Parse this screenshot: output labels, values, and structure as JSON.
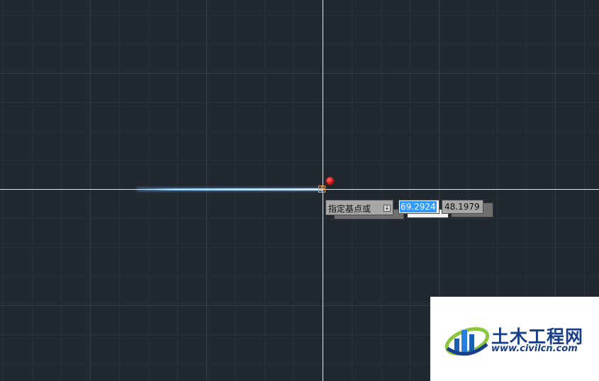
{
  "dynamic_input": {
    "prompt": "指定基点或",
    "menu_arrow_glyph": "↓",
    "x_value": "69.2924",
    "y_value": "48.1979"
  },
  "watermark": {
    "title": "土木工程网",
    "url": "www.civilcn.com"
  },
  "colors": {
    "background": "#212830",
    "crosshair": "#e8e8e8",
    "rubber_band": "#a9d3ff",
    "selection": "#3399ff",
    "marker": "#d01010",
    "brand": "#1a3f8a"
  }
}
